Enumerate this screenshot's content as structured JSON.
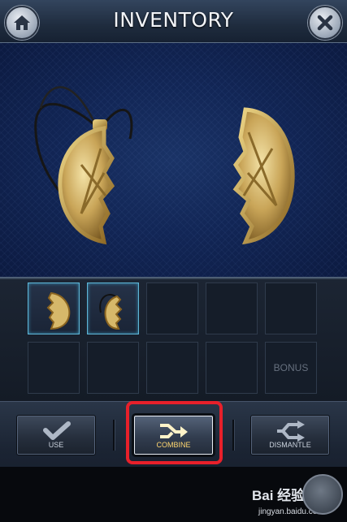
{
  "header": {
    "title": "INVENTORY",
    "home_icon": "home-icon",
    "close_icon": "close-icon"
  },
  "colors": {
    "header_bg": "#1f2c3e",
    "display_bg": "#122656",
    "slot_highlight": "#5fb7d8",
    "combine_label": "#ffd770",
    "highlight_frame": "#e8202a"
  },
  "preview": {
    "items": [
      "medallion-half-with-cord",
      "medallion-half"
    ]
  },
  "inventory": {
    "slots": [
      {
        "item": "medallion-half",
        "selected": true
      },
      {
        "item": "medallion-half-with-cord",
        "selected": true
      },
      {
        "item": ""
      },
      {
        "item": ""
      },
      {
        "item": ""
      },
      {
        "item": ""
      },
      {
        "item": ""
      },
      {
        "item": ""
      },
      {
        "item": ""
      },
      {
        "item": "",
        "label": "BONUS"
      }
    ]
  },
  "actions": {
    "use": {
      "label": "USE",
      "icon": "check-icon"
    },
    "combine": {
      "label": "COMBINE",
      "icon": "merge-arrow-icon"
    },
    "dismantle": {
      "label": "DISMANTLE",
      "icon": "split-arrows-icon"
    }
  },
  "watermark": {
    "logo": "Bai 经验",
    "url": "jingyan.baidu.com"
  }
}
